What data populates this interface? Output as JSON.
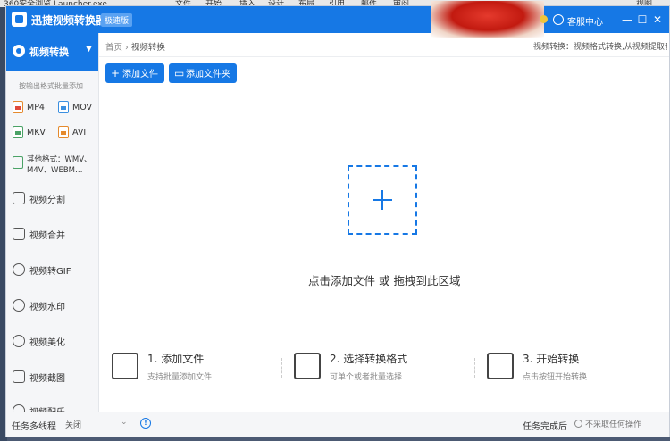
{
  "desktop": {
    "menu_items": [
      "文件",
      "开始",
      "插入",
      "设计",
      "布局",
      "引用",
      "邮件",
      "审阅",
      "视图"
    ],
    "side_text": "360安全浏览 Launcher.exe"
  },
  "titlebar": {
    "app_name": "迅捷视频转换器",
    "edition": "极速版",
    "support_label": "客服中心",
    "min_glyph": "—",
    "max_glyph": "☐",
    "close_glyph": "✕",
    "accent_color": "#1678e5"
  },
  "sidebar": {
    "active": {
      "label": "视频转换",
      "icon": "convert-icon",
      "arrow": "▼"
    },
    "hint": "按输出格式批量添加",
    "formats": [
      {
        "label": "MP4",
        "icon": "mp4-file-icon"
      },
      {
        "label": "MOV",
        "icon": "mov-file-icon"
      },
      {
        "label": "MKV",
        "icon": "mkv-file-icon"
      },
      {
        "label": "AVI",
        "icon": "avi-file-icon"
      }
    ],
    "other_formats": "其他格式：WMV、M4V、WEBM…",
    "items": [
      {
        "label": "视频分割",
        "icon": "split-icon"
      },
      {
        "label": "视频合并",
        "icon": "merge-icon"
      },
      {
        "label": "视频转GIF",
        "icon": "gif-icon"
      },
      {
        "label": "视频水印",
        "icon": "watermark-icon"
      },
      {
        "label": "视频美化",
        "icon": "beautify-icon"
      },
      {
        "label": "视频截图",
        "icon": "screenshot-icon"
      },
      {
        "label": "视频配乐",
        "icon": "music-icon"
      }
    ]
  },
  "main": {
    "breadcrumb": {
      "home": "首页",
      "sep": "›",
      "current": "视频转换"
    },
    "header_desc": "视频转换：视频格式转换,从视频提取音频",
    "add_file_label": "添加文件",
    "add_folder_label": "添加文件夹",
    "drop_text": "点击添加文件 或 拖拽到此区域",
    "steps": [
      {
        "title": "1. 添加文件",
        "subtitle": "支持批量添加文件",
        "icon": "add-file-icon"
      },
      {
        "title": "2. 选择转换格式",
        "subtitle": "可单个或者批量选择",
        "icon": "format-switch-icon"
      },
      {
        "title": "3. 开始转换",
        "subtitle": "点击按钮开始转换",
        "icon": "start-convert-icon"
      }
    ]
  },
  "statusbar": {
    "multithread_label": "任务多线程",
    "multithread_value": "关闭",
    "chevron": "⌄",
    "info_glyph": "!",
    "done_label": "任务完成后",
    "action_label": "不采取任何操作"
  }
}
